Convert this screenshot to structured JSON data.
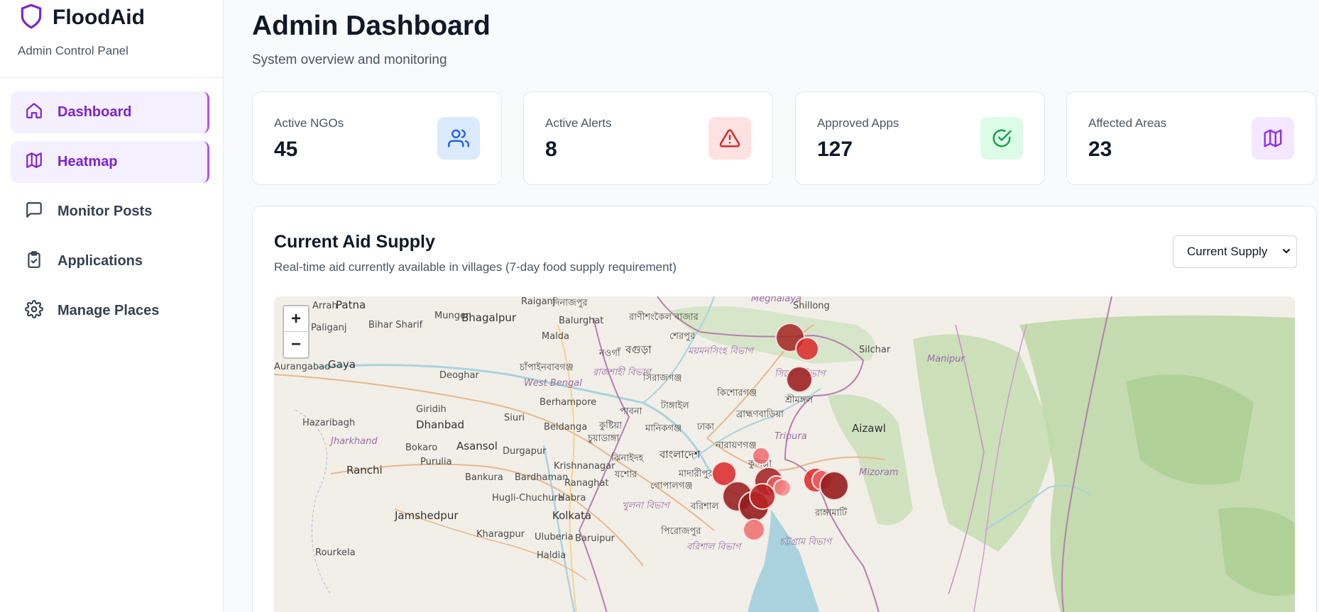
{
  "brand": {
    "name": "FloodAid",
    "subtitle": "Admin Control Panel",
    "accent": "#7e22ce"
  },
  "sidebar": {
    "items": [
      {
        "label": "Dashboard",
        "icon": "home-icon",
        "active": true
      },
      {
        "label": "Heatmap",
        "icon": "map-icon",
        "active": true
      },
      {
        "label": "Monitor Posts",
        "icon": "message-square-icon",
        "active": false
      },
      {
        "label": "Applications",
        "icon": "clipboard-check-icon",
        "active": false
      },
      {
        "label": "Manage Places",
        "icon": "gear-icon",
        "active": false
      }
    ]
  },
  "header": {
    "title": "Admin Dashboard",
    "subtitle": "System overview and monitoring"
  },
  "stats": [
    {
      "label": "Active NGOs",
      "value": "45",
      "icon": "users-icon",
      "color": "#2563eb",
      "bg": "#dbeafe"
    },
    {
      "label": "Active Alerts",
      "value": "8",
      "icon": "alert-triangle-icon",
      "color": "#dc2626",
      "bg": "#fee2e2"
    },
    {
      "label": "Approved Apps",
      "value": "127",
      "icon": "check-circle-icon",
      "color": "#16a34a",
      "bg": "#dcfce7"
    },
    {
      "label": "Affected Areas",
      "value": "23",
      "icon": "map-icon",
      "color": "#9333ea",
      "bg": "#f3e8ff"
    }
  ],
  "supply_panel": {
    "title": "Current Aid Supply",
    "subtitle": "Real-time aid currently available in villages (7-day food supply requirement)",
    "layers_icon": "layers-icon",
    "select": {
      "selected": "Current Supply"
    }
  },
  "map": {
    "zoom_in": "+",
    "zoom_out": "−",
    "labels": [
      "Patna",
      "Raiganj",
      "দিনাজপুর",
      "Meghalaya",
      "Shillong",
      "Arrah",
      "Paliganj",
      "Bihar Sharif",
      "Munger",
      "Bhagalpur",
      "Balurghat",
      "রাণীশংকৈল বাজার",
      "শেরপুর",
      "Malda",
      "নওগাঁ",
      "বগুড়া",
      "ময়মনসিংহ বিভাগ",
      "Silchar",
      "Aurangabad",
      "Gaya",
      "Deoghar",
      "চাঁপাইনবাবগঞ্জ",
      "রাজশাহী বিভাগ",
      "সিরাজগঞ্জ",
      "West Bengal",
      "সিলেট বিভাগ",
      "Manipur",
      "Giridih",
      "Berhampore",
      "Siuri",
      "কিশোরগঞ্জ",
      "শ্রীমঙ্গল",
      "Hazaribagh",
      "Jharkhand",
      "Dhanbad",
      "Beldanga",
      "কুষ্টিয়া",
      "পাবনা",
      "টাঙ্গাইল",
      "ব্রাহ্মণবাড়িয়া",
      "Aizawl",
      "চুয়াডাঙ্গা",
      "মানিকগঞ্জ",
      "ঢাকা",
      "Bokaro",
      "Asansol",
      "Durgapur",
      "নারায়ণগঞ্জ",
      "Tripura",
      "Purulia",
      "ঝিনাইদহ",
      "বাংলাদেশ",
      "Krishnanagar",
      "Ranchi",
      "Bankura",
      "Bardhaman",
      "মাদারীপুর",
      "যশোর",
      "কুমিল্লা",
      "Ranaghat",
      "গোপালগঞ্জ",
      "Mizoram",
      "Hugli-Chuchura",
      "Habra",
      "খুলনা বিভাগ",
      "বরিশাল",
      "রাঙ্গামাটি",
      "Jamshedpur",
      "Kolkata",
      "Kharagpur",
      "Uluberia",
      "Baruipur",
      "পিরোজপুর",
      "চট্টগ্রাম বিভাগ",
      "Rourkela",
      "Haldia",
      "বরিশাল বিভাগ"
    ]
  }
}
